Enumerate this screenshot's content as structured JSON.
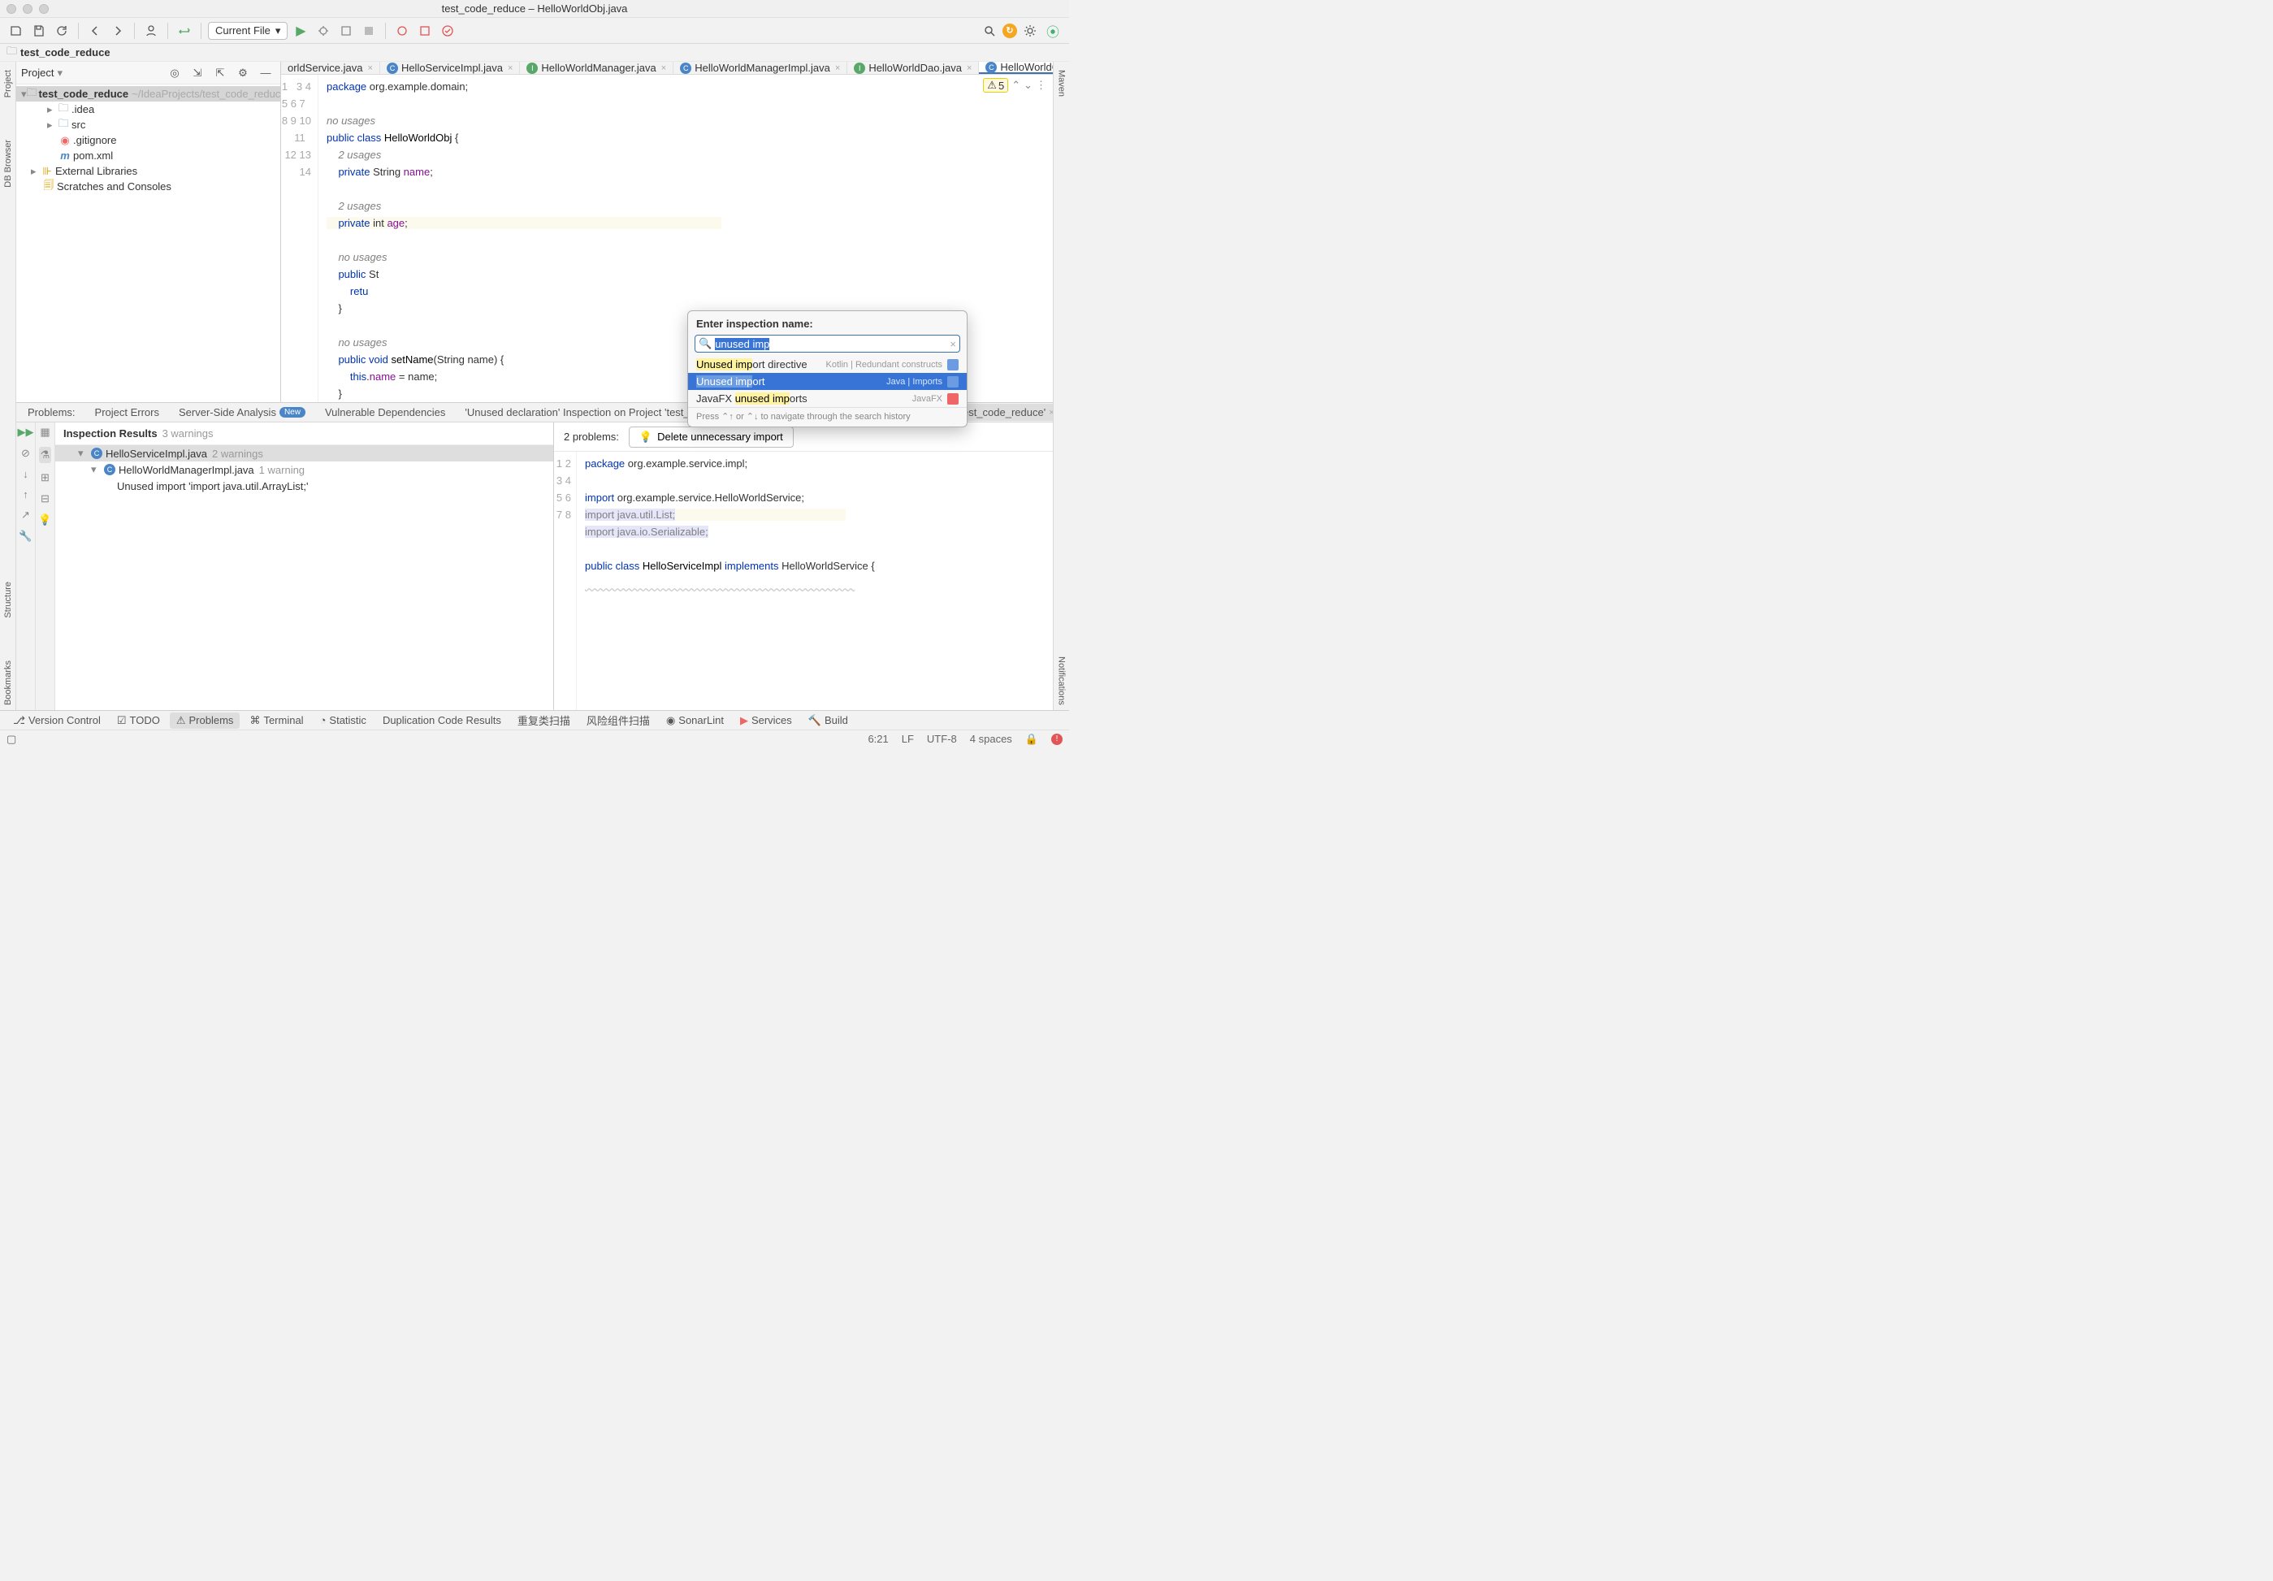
{
  "title": "test_code_reduce – HelloWorldObj.java",
  "breadcrumb": "test_code_reduce",
  "toolbar": {
    "config": "Current File"
  },
  "project_header": "Project",
  "tree": {
    "root": "test_code_reduce",
    "root_path": "~/IdeaProjects/test_code_reduce",
    "idea": ".idea",
    "src": "src",
    "gitignore": ".gitignore",
    "pom": "pom.xml",
    "ext": "External Libraries",
    "scratch": "Scratches and Consoles"
  },
  "tabs": [
    {
      "label": "orldService.java",
      "icon": "i"
    },
    {
      "label": "HelloServiceImpl.java",
      "icon": "c"
    },
    {
      "label": "HelloWorldManager.java",
      "icon": "i"
    },
    {
      "label": "HelloWorldManagerImpl.java",
      "icon": "c"
    },
    {
      "label": "HelloWorldDao.java",
      "icon": "i"
    },
    {
      "label": "HelloWorldObj.java",
      "icon": "c",
      "active": true
    }
  ],
  "code_status": {
    "warnings": "5"
  },
  "editor_lines": [
    "1",
    "",
    "3",
    "4",
    "5",
    "6",
    "7",
    "",
    "8",
    "9",
    "10",
    "11",
    "",
    "12",
    "13",
    "14"
  ],
  "popup": {
    "title": "Enter inspection name:",
    "query": "unused imp",
    "hint": "Press ⌃↑ or ⌃↓ to navigate through the search history",
    "items": [
      {
        "name": "Unused import directive",
        "hl": "Unused imp",
        "rest": "ort directive",
        "cat": "Kotlin | Redundant constructs",
        "badge": "lang"
      },
      {
        "name": "Unused import",
        "hl": "Unused imp",
        "rest": "ort",
        "cat": "Java | Imports",
        "badge": "lang",
        "sel": true
      },
      {
        "name": "JavaFX unused imports",
        "pre": "JavaFX ",
        "hl": "unused imp",
        "rest": "orts",
        "cat": "JavaFX",
        "badge": "fx"
      }
    ]
  },
  "problems_tabs": {
    "problems": "Problems:",
    "project_errors": "Project Errors",
    "server": "Server-Side Analysis",
    "new": "New",
    "vuln": "Vulnerable Dependencies",
    "unused_decl": "'Unused declaration' Inspection on Project 'test_code_reduce'",
    "unused_import": "'Unused import' Inspection on Project 'test_code_reduce'"
  },
  "inspection": {
    "header": "Inspection Results",
    "header_cnt": "3 warnings",
    "file1": "HelloServiceImpl.java",
    "file1_cnt": "2 warnings",
    "file2": "HelloWorldManagerImpl.java",
    "file2_cnt": "1 warning",
    "issue": "Unused import 'import java.util.ArrayList;'"
  },
  "preview": {
    "problems": "2 problems:",
    "delete_btn": "Delete unnecessary import",
    "lines": [
      "1",
      "2",
      "3",
      "4",
      "5",
      "6",
      "7",
      "8"
    ]
  },
  "footer": {
    "vcs": "Version Control",
    "todo": "TODO",
    "problems": "Problems",
    "terminal": "Terminal",
    "statistic": "Statistic",
    "dup": "Duplication Code Results",
    "chongfu": "重复类扫描",
    "fengxian": "风险组件扫描",
    "sonar": "SonarLint",
    "services": "Services",
    "build": "Build"
  },
  "status": {
    "pos": "6:21",
    "lf": "LF",
    "enc": "UTF-8",
    "indent": "4 spaces"
  },
  "side_tabs": {
    "proj": "Project",
    "db": "DB Browser",
    "structure": "Structure",
    "bookmarks": "Bookmarks",
    "maven": "Maven",
    "notif": "Notifications"
  }
}
